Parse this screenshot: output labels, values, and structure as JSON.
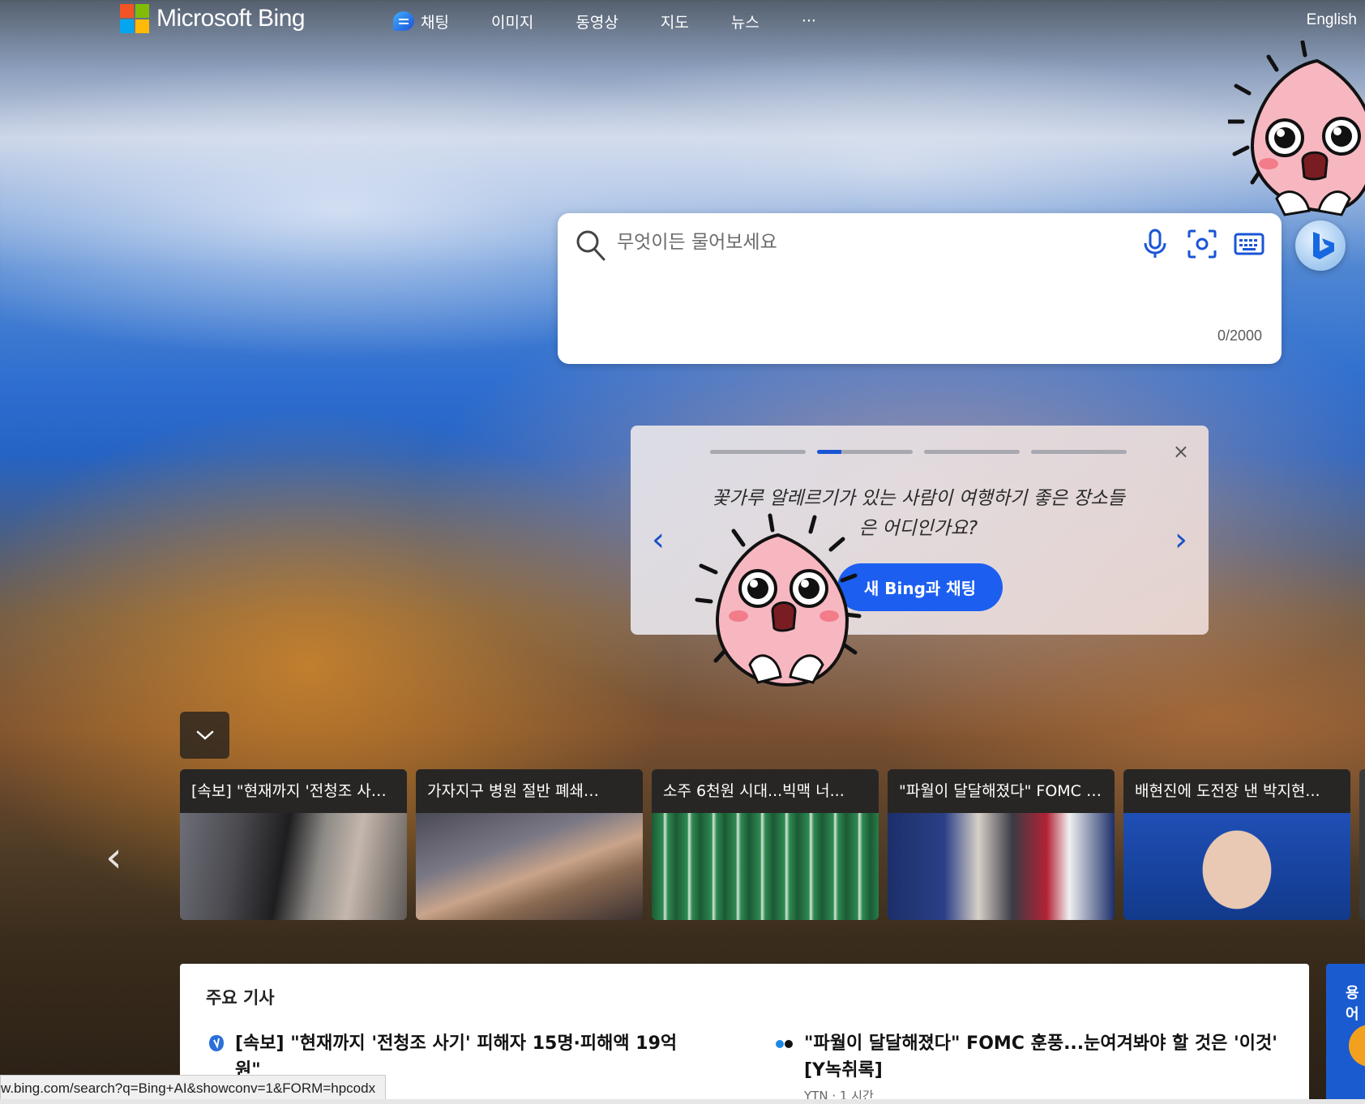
{
  "header": {
    "brand": "Microsoft Bing",
    "nav": [
      {
        "label": "채팅",
        "icon": "chat-bubble-icon"
      },
      {
        "label": "이미지"
      },
      {
        "label": "동영상"
      },
      {
        "label": "지도"
      },
      {
        "label": "뉴스"
      },
      {
        "label": "···"
      }
    ],
    "language": "English"
  },
  "search": {
    "placeholder": "무엇이든 물어보세요",
    "counter": "0/2000",
    "tools": [
      "microphone-icon",
      "visual-search-icon",
      "keyboard-icon"
    ]
  },
  "promo": {
    "text": "꽃가루 알레르기가 있는 사람이 여행하기 좋은 장소들은 어디인가요?",
    "button": "새 Bing과 채팅",
    "close": "×",
    "prev": "‹",
    "next": "›",
    "progress": [
      0,
      0.25,
      0,
      0
    ]
  },
  "news_cards": [
    {
      "title": "[속보] \"현재까지 '전청조 사기' 피해자 15명·피해액 19억원\""
    },
    {
      "title": "가자지구 병원 절반 폐쇄…"
    },
    {
      "title": "소주 6천원 시대...빅맥 너..."
    },
    {
      "title": "\"파월이 달달해졌다\" FOMC 훈풍"
    },
    {
      "title": "배현진에 도전장 낸 박지현..."
    }
  ],
  "top_news": {
    "title": "주요 기사",
    "articles": [
      {
        "headline": "[속보] \"현재까지 '전청조 사기' 피해자 15명·피해액 19억원\"",
        "meta": ""
      },
      {
        "headline": "\"파월이 달달해졌다\" FOMC 훈풍...눈여겨봐야 할 것은 '이것' [Y녹취록]",
        "meta": "YTN · 1 시간"
      }
    ]
  },
  "side_panel": {
    "label": "용어"
  },
  "status_url": "w.bing.com/search?q=Bing+AI&showconv=1&FORM=hpcodx",
  "colors": {
    "accent": "#1c5ff0",
    "ms_red": "#f35325",
    "ms_green": "#81bc06",
    "ms_blue": "#05a6f0",
    "ms_yellow": "#ffba08"
  }
}
